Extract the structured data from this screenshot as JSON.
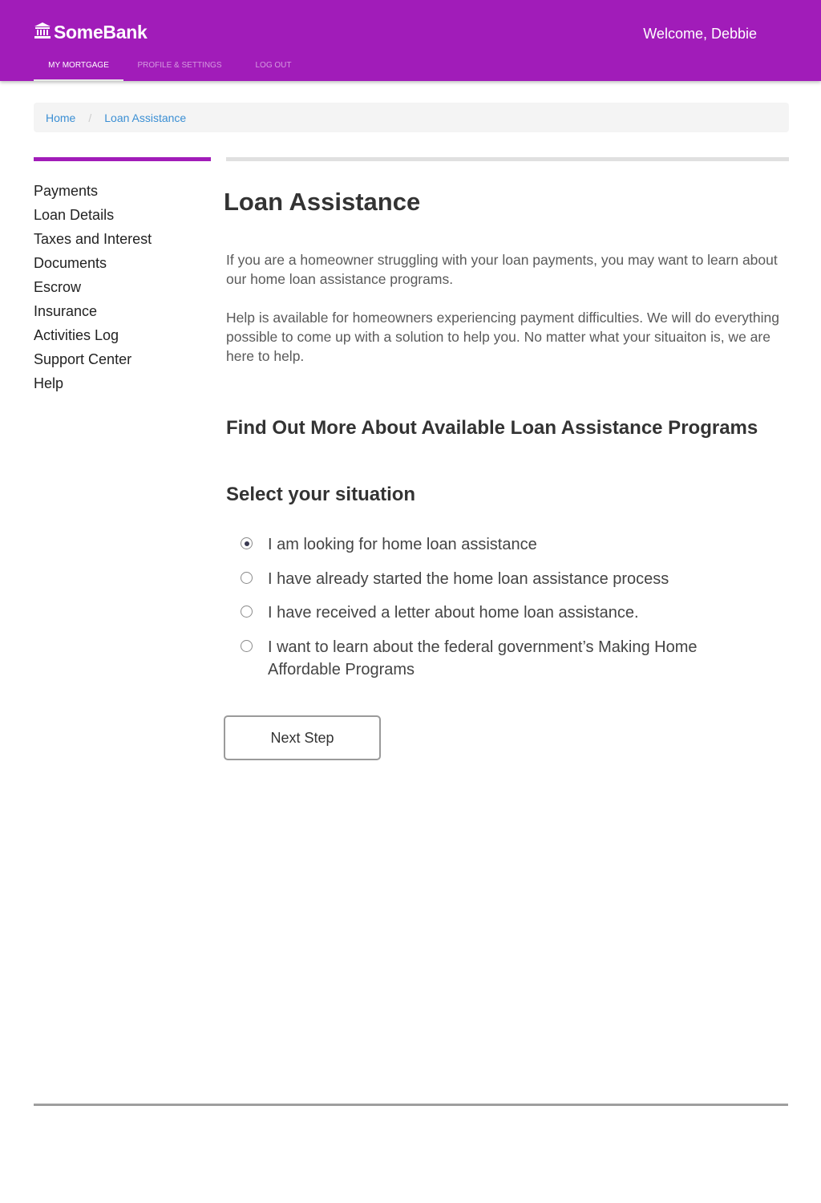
{
  "header": {
    "logo_text": "SomeBank",
    "logo_icon": "bank-icon",
    "welcome": "Welcome, Debbie",
    "brand_color": "#a11cb9",
    "tabs": [
      {
        "label": "My Mortgage",
        "active": true
      },
      {
        "label": "Profile & Settings",
        "active": false
      },
      {
        "label": "Log Out",
        "active": false
      }
    ]
  },
  "breadcrumb": {
    "items": [
      "Home",
      "Loan Assistance"
    ],
    "separator": "/"
  },
  "sidebar": {
    "items": [
      {
        "label": "Payments"
      },
      {
        "label": "Loan Details"
      },
      {
        "label": "Taxes and Interest"
      },
      {
        "label": "Documents"
      },
      {
        "label": "Escrow"
      },
      {
        "label": "Insurance"
      },
      {
        "label": "Activities Log"
      },
      {
        "label": "Support Center"
      },
      {
        "label": "Help"
      }
    ]
  },
  "main": {
    "title": "Loan Assistance",
    "paragraphs": [
      "If you are a homeowner struggling with your loan payments, you may want to learn about our home loan assistance programs.",
      "Help is available for homeowners experiencing payment difficulties. We will do everything possible to come up with a solution to help you. No matter what your situaiton is, we are here to help."
    ],
    "subheading": "Find Out More About Available Loan Assistance Programs",
    "situation_label": "Select your situation",
    "options": [
      {
        "label": "I am looking for home loan assistance",
        "selected": true
      },
      {
        "label": "I have already started the home loan assistance process",
        "selected": false
      },
      {
        "label": "I have received a letter about home loan assistance.",
        "selected": false
      },
      {
        "label": "I want to learn about the federal government’s Making Home Affordable Programs",
        "selected": false
      }
    ],
    "next_button": "Next Step"
  }
}
